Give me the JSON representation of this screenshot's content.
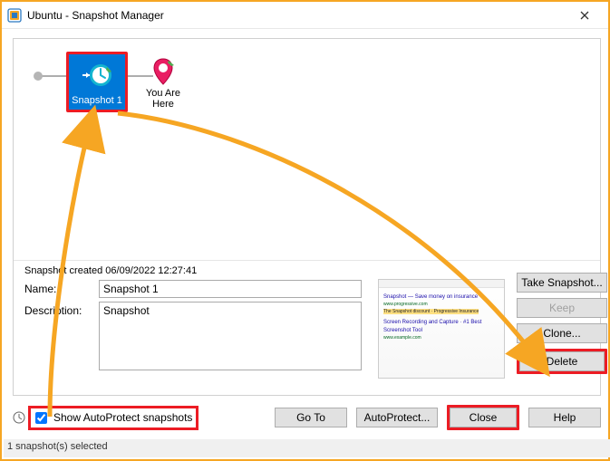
{
  "title": "Ubuntu - Snapshot Manager",
  "snapshot_node_label": "Snapshot 1",
  "you_are_here_label": "You Are\nHere",
  "created_line": "Snapshot created 06/09/2022 12:27:41",
  "labels": {
    "name": "Name:",
    "description": "Description:"
  },
  "fields": {
    "name": "Snapshot 1",
    "description": "Snapshot"
  },
  "right_buttons": {
    "take": "Take Snapshot...",
    "keep": "Keep",
    "clone": "Clone...",
    "delete": "Delete"
  },
  "bottom": {
    "autoprotect_label": "Show AutoProtect snapshots",
    "goto": "Go To",
    "autoprotect_btn": "AutoProtect...",
    "close": "Close",
    "help": "Help"
  },
  "statusbar": "1 snapshot(s) selected"
}
